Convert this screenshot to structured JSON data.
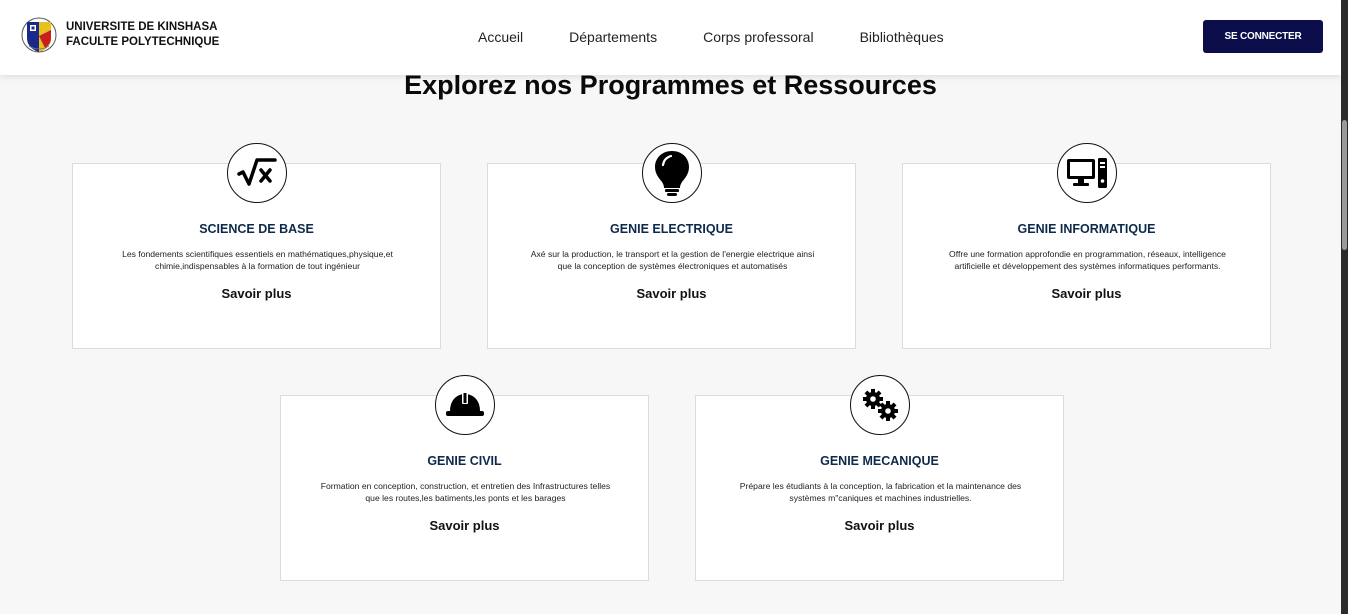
{
  "header": {
    "university": "UNIVERSITE DE KINSHASA",
    "faculty": "FACULTE POLYTECHNIQUE",
    "nav": [
      "Accueil",
      "Départements",
      "Corps professoral",
      "Bibliothèques"
    ],
    "login_label": "SE CONNECTER"
  },
  "section": {
    "title": "Explorez nos Programmes et Ressources"
  },
  "cards": [
    {
      "icon": "math-sqrt-icon",
      "title": "SCIENCE DE BASE",
      "desc_line1": "Les fondements scientifiques essentiels en mathématiques,physique,et",
      "desc_line2": "chimie,indispensables à la formation de tout ingénieur",
      "link": "Savoir plus"
    },
    {
      "icon": "lightbulb-icon",
      "title": "GENIE ELECTRIQUE",
      "desc_line1": "Axé sur la production, le transport et la gestion de l'energie electrique ainsi",
      "desc_line2": "que la conception de systèmes électroniques et automatisés",
      "link": "Savoir plus"
    },
    {
      "icon": "computer-icon",
      "title": "GENIE INFORMATIQUE",
      "desc_line1": "Offre une formation approfondie en programmation, réseaux, intelligence",
      "desc_line2": "artificielle et développement des systèmes informatiques performants.",
      "link": "Savoir plus"
    },
    {
      "icon": "hard-hat-icon",
      "title": "GENIE CIVIL",
      "desc_line1": "Formation en conception, construction, et entretien des Infrastructures telles",
      "desc_line2": "que les routes,les batiments,les ponts et les barages",
      "link": "Savoir plus"
    },
    {
      "icon": "gears-icon",
      "title": "GENIE MECANIQUE",
      "desc_line1": "Prépare les étudiants à la conception, la fabrication et la maintenance des",
      "desc_line2": "systèmes m\"caniques et machines industrielles.",
      "link": "Savoir plus"
    }
  ],
  "colors": {
    "button_bg": "#0b0e4a",
    "card_title": "#0e2a4a",
    "page_bg": "#f7f7f7"
  }
}
